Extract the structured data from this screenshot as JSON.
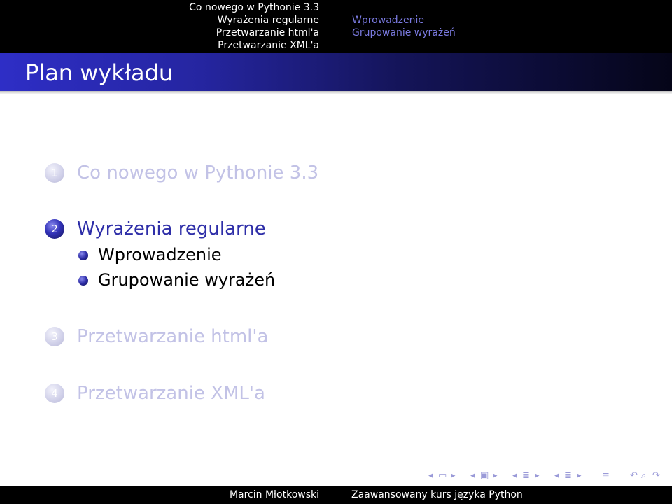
{
  "header_nav": {
    "sections": [
      {
        "label": "Co nowego w Pythonie 3.3",
        "current": true
      },
      {
        "label": "Wyrażenia regularne",
        "current": true
      },
      {
        "label": "Przetwarzanie html'a",
        "current": false
      },
      {
        "label": "Przetwarzanie XML'a",
        "current": false
      }
    ],
    "subsections": [
      {
        "label": "Wprowadzenie"
      },
      {
        "label": "Grupowanie wyrażeń"
      }
    ]
  },
  "frame": {
    "title": "Plan wykładu"
  },
  "outline": {
    "sections": [
      {
        "number": "1",
        "title": "Co nowego w Pythonie 3.3",
        "state": "shaded"
      },
      {
        "number": "2",
        "title": "Wyrażenia regularne",
        "state": "active",
        "subsections": [
          "Wprowadzenie",
          "Grupowanie wyrażeń"
        ]
      },
      {
        "number": "3",
        "title": "Przetwarzanie html'a",
        "state": "shaded"
      },
      {
        "number": "4",
        "title": "Przetwarzanie XML'a",
        "state": "shaded"
      }
    ]
  },
  "footer": {
    "author": "Marcin Młotkowski",
    "course": "Zaawansowany kurs języka Python"
  },
  "colors": {
    "accent": "#2e2ea8",
    "shaded_text": "#c2c2e6",
    "bar": "#000000"
  }
}
